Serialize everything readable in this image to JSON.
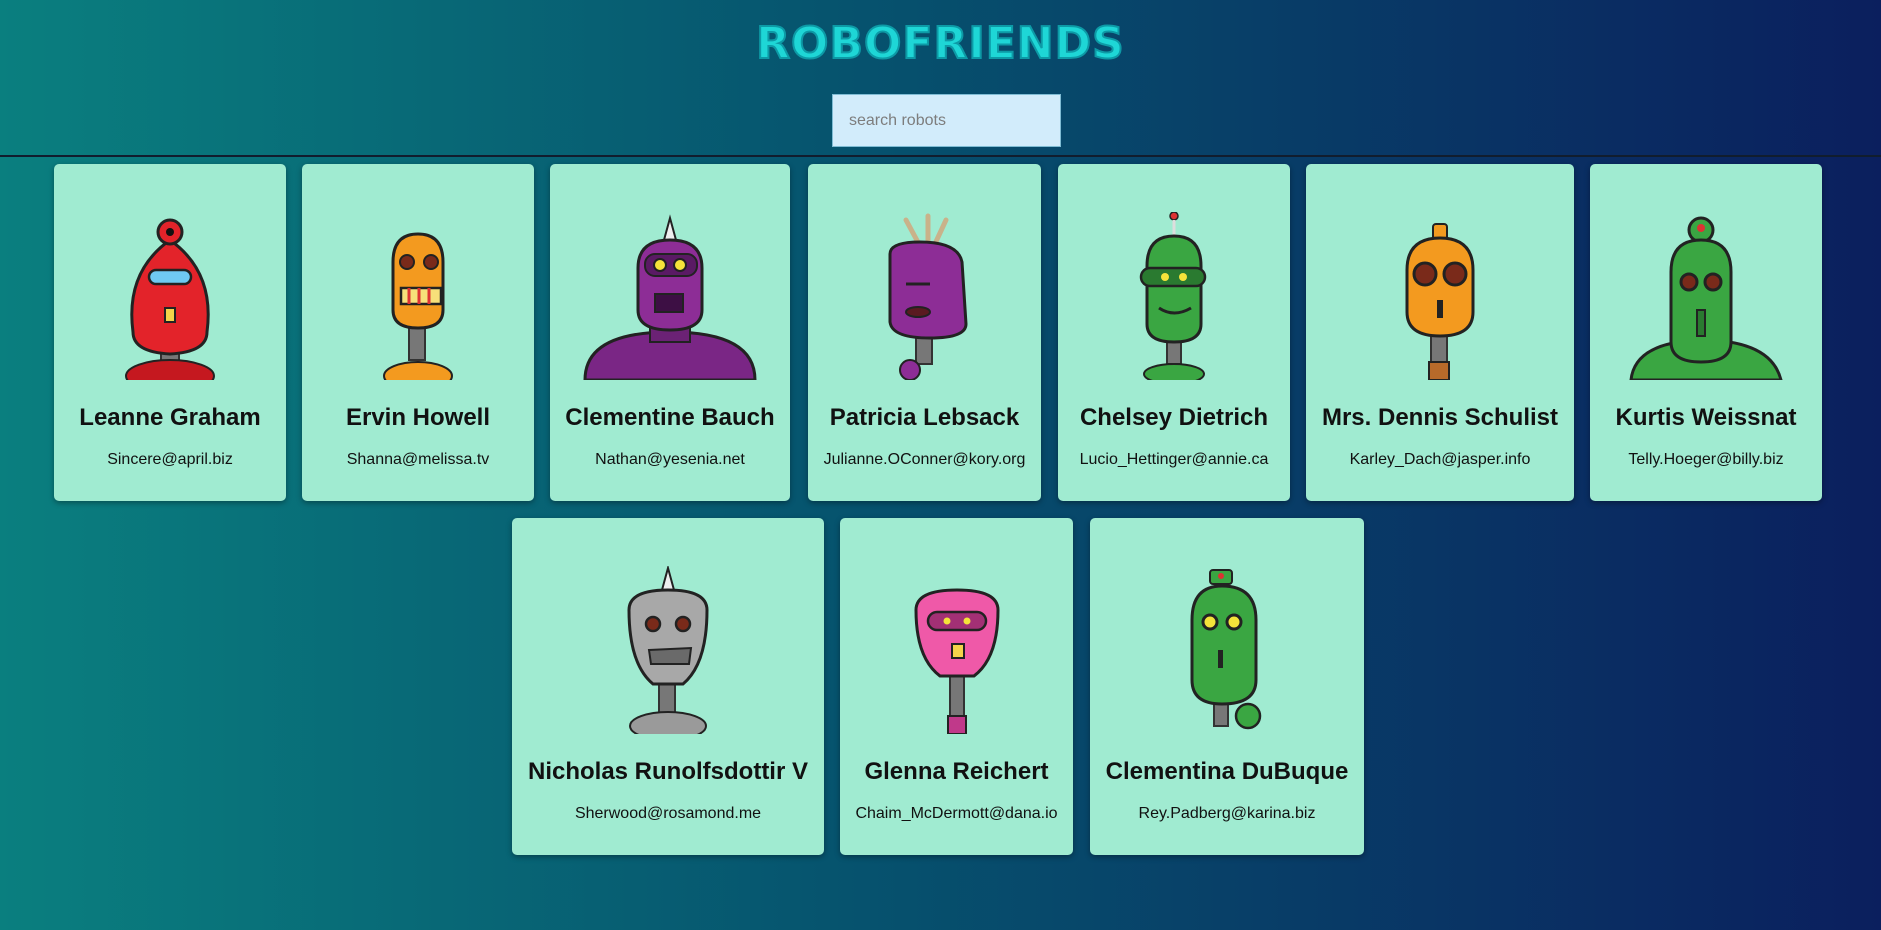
{
  "app": {
    "title": "ROBOFRIENDS"
  },
  "search": {
    "placeholder": "search robots"
  },
  "robots": [
    {
      "name": "Leanne Graham",
      "email": "Sincere@april.biz",
      "color": "#e3232a"
    },
    {
      "name": "Ervin Howell",
      "email": "Shanna@melissa.tv",
      "color": "#f39a1f"
    },
    {
      "name": "Clementine Bauch",
      "email": "Nathan@yesenia.net",
      "color": "#8d2d96"
    },
    {
      "name": "Patricia Lebsack",
      "email": "Julianne.OConner@kory.org",
      "color": "#8d2d96"
    },
    {
      "name": "Chelsey Dietrich",
      "email": "Lucio_Hettinger@annie.ca",
      "color": "#3aa642"
    },
    {
      "name": "Mrs. Dennis Schulist",
      "email": "Karley_Dach@jasper.info",
      "color": "#f39a1f"
    },
    {
      "name": "Kurtis Weissnat",
      "email": "Telly.Hoeger@billy.biz",
      "color": "#3aa642"
    },
    {
      "name": "Nicholas Runolfsdottir V",
      "email": "Sherwood@rosamond.me",
      "color": "#9a9a9a"
    },
    {
      "name": "Glenna Reichert",
      "email": "Chaim_McDermott@dana.io",
      "color": "#ef59a8"
    },
    {
      "name": "Clementina DuBuque",
      "email": "Rey.Padberg@karina.biz",
      "color": "#3aa642"
    }
  ]
}
